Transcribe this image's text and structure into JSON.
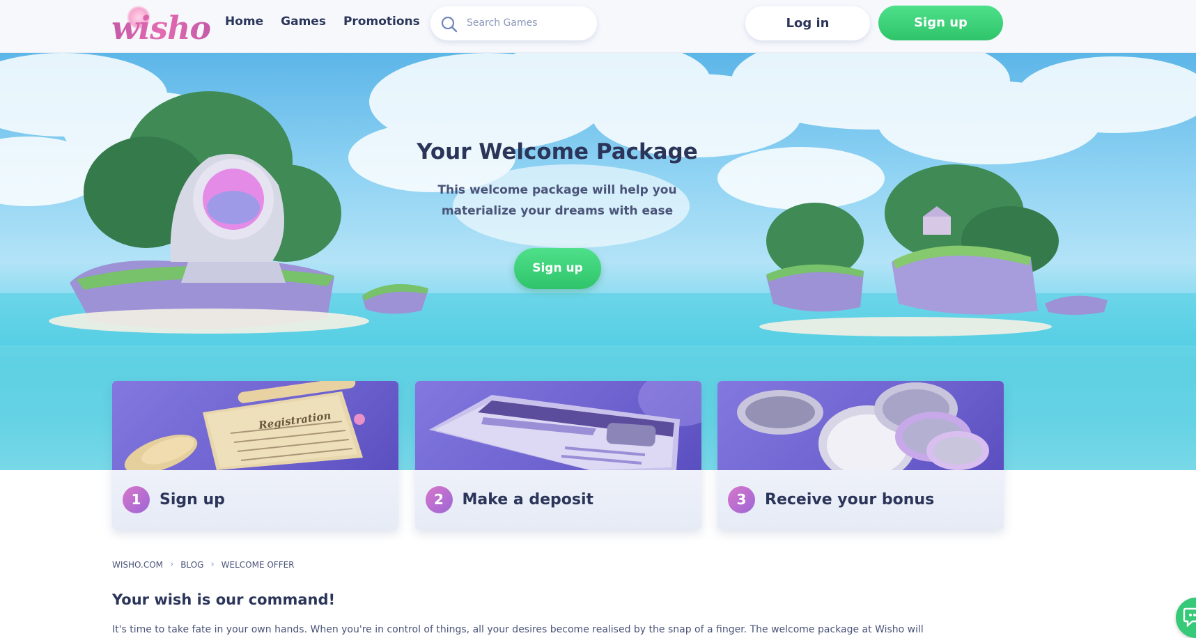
{
  "brand": {
    "logo_text": "wisho"
  },
  "header": {
    "nav": [
      "Home",
      "Games",
      "Promotions"
    ],
    "search_placeholder": "Search Games",
    "login_label": "Log in",
    "signup_label": "Sign up"
  },
  "hero": {
    "title": "Your Welcome Package",
    "subtitle_line1": "This welcome package will help you",
    "subtitle_line2": "materialize your dreams with ease",
    "cta_label": "Sign up"
  },
  "steps": [
    {
      "number": "1",
      "label": "Sign up",
      "image_text": "Registration",
      "icon": "registration-scroll-icon"
    },
    {
      "number": "2",
      "label": "Make a deposit",
      "icon": "credit-card-icon"
    },
    {
      "number": "3",
      "label": "Receive your bonus",
      "icon": "coins-icon"
    }
  ],
  "breadcrumb": [
    "WISHO.COM",
    "BLOG",
    "WELCOME OFFER"
  ],
  "content": {
    "title": "Your wish is our command!",
    "text": "It's time to take fate in your own hands. When you're in control of things, all your desires become realised by the snap of a finger. The welcome package at Wisho will"
  },
  "colors": {
    "accent_green": "#35c978",
    "text_dark": "#2b3559",
    "brand_pink": "#d760ad",
    "step_purple": "#6e62cf"
  }
}
